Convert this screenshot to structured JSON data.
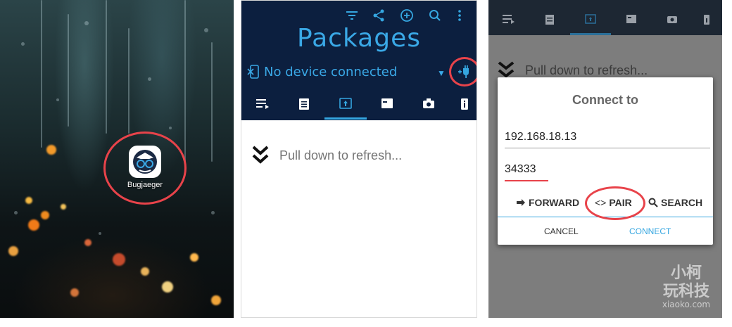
{
  "home": {
    "app_label": "Bugjaeger"
  },
  "packages": {
    "title": "Packages",
    "device_status": "No device connected",
    "pull_to_refresh": "Pull down to refresh...",
    "tabs": [
      "logcat",
      "shell",
      "packages",
      "files",
      "screenshot",
      "device-info"
    ],
    "selected_tab": "packages"
  },
  "dialog": {
    "title": "Connect to",
    "ip_value": "192.168.18.13",
    "port_value": "34333",
    "forward_label": "FORWARD",
    "pair_label": "PAIR",
    "search_label": "SEARCH",
    "cancel_label": "CANCEL",
    "connect_label": "CONNECT",
    "background_hint": "Pull down to refresh..."
  },
  "watermark": {
    "line1": "小柯",
    "line2": "玩科技",
    "line3": "xiaoko.com"
  },
  "colors": {
    "header_bg": "#0c1f3f",
    "accent_blue": "#35a6e0",
    "highlight_circle": "#e8434a"
  }
}
